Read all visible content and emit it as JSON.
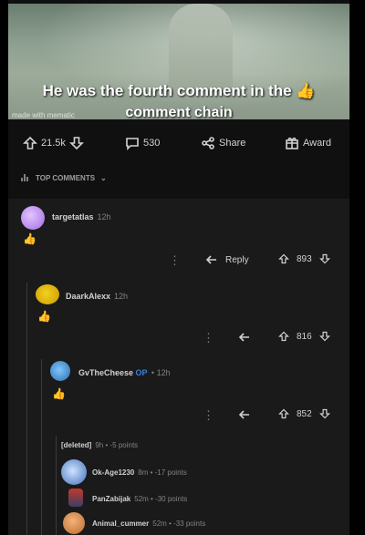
{
  "meme": {
    "caption_line1": "He was the fourth comment in the 👍",
    "caption_line2": "comment chain",
    "watermark": "made with mematic"
  },
  "post_actions": {
    "votes": "21.5k",
    "comments": "530",
    "share": "Share",
    "award": "Award"
  },
  "sort_label": "TOP COMMENTS",
  "comments": [
    {
      "user": "targetatlas",
      "time": "12h",
      "body": "👍",
      "reply": "Reply",
      "score": "893"
    },
    {
      "user": "DaarkAlexx",
      "time": "12h",
      "body": "👍",
      "score": "816"
    },
    {
      "user": "GvTheCheese",
      "op": "OP",
      "time": "12h",
      "body": "👍",
      "score": "852"
    }
  ],
  "collapsed": [
    {
      "user": "[deleted]",
      "meta": "9h • -5 points"
    },
    {
      "user": "Ok-Age1230",
      "meta": "8m • -17 points"
    },
    {
      "user": "PanZabijak",
      "meta": "52m • -30 points"
    },
    {
      "user": "Animal_cummer",
      "meta": "52m • -33 points"
    }
  ]
}
